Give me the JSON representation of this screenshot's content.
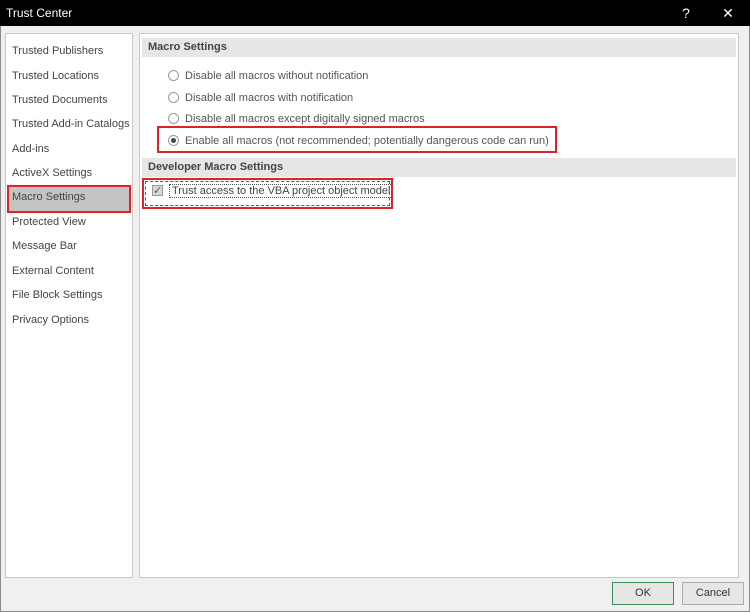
{
  "window": {
    "title": "Trust Center",
    "help_label": "?",
    "close_label": "✕"
  },
  "sidebar": {
    "items": [
      {
        "label": "Trusted Publishers"
      },
      {
        "label": "Trusted Locations"
      },
      {
        "label": "Trusted Documents"
      },
      {
        "label": "Trusted Add-in Catalogs"
      },
      {
        "label": "Add-ins"
      },
      {
        "label": "ActiveX Settings"
      },
      {
        "label": "Macro Settings",
        "selected": true
      },
      {
        "label": "Protected View"
      },
      {
        "label": "Message Bar"
      },
      {
        "label": "External Content"
      },
      {
        "label": "File Block Settings"
      },
      {
        "label": "Privacy Options"
      }
    ]
  },
  "macro_settings": {
    "header": "Macro Settings",
    "options": [
      {
        "label": "Disable all macros without notification",
        "checked": false
      },
      {
        "label": "Disable all macros with notification",
        "checked": false
      },
      {
        "label": "Disable all macros except digitally signed macros",
        "checked": false
      },
      {
        "label": "Enable all macros (not recommended; potentially dangerous code can run)",
        "checked": true
      }
    ]
  },
  "developer_settings": {
    "header": "Developer Macro Settings",
    "vba_access_label": "Trust access to the VBA project object model",
    "vba_access_checked": true
  },
  "footer": {
    "ok_label": "OK",
    "cancel_label": "Cancel"
  },
  "colors": {
    "highlight": "#d9252a",
    "title_bar": "#000000",
    "selected_bg": "#c4c4c4"
  }
}
